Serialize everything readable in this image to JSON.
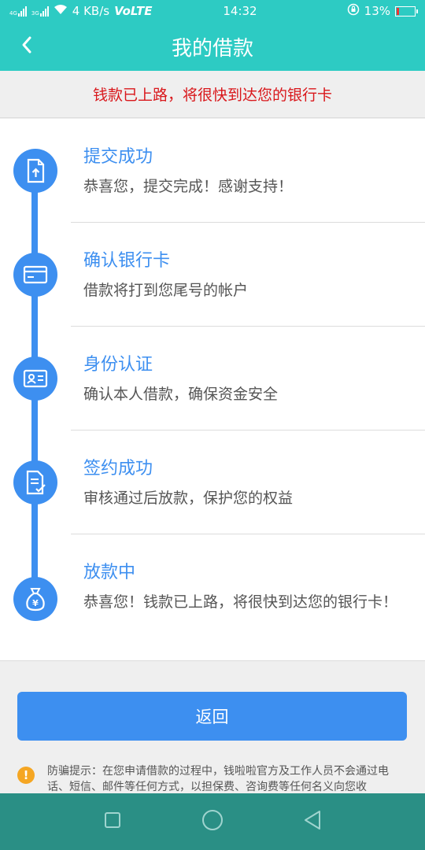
{
  "status_bar": {
    "network_speed": "4 KB/s",
    "volte": "VoLTE",
    "time": "14:32",
    "battery_percent": "13%",
    "battery_level": 0.13,
    "network_labels": [
      "4G",
      "3G"
    ]
  },
  "nav": {
    "title": "我的借款",
    "back_icon": "chevron-left-icon"
  },
  "banner": {
    "message": "钱款已上路，将很快到达您的银行卡"
  },
  "steps": [
    {
      "title": "提交成功",
      "desc": "恭喜您，提交完成！感谢支持！",
      "icon": "document-upload-icon"
    },
    {
      "title": "确认银行卡",
      "desc": "借款将打到您尾号的帐户",
      "icon": "bank-card-icon"
    },
    {
      "title": "身份认证",
      "desc": "确认本人借款，确保资金安全",
      "icon": "id-card-icon"
    },
    {
      "title": "签约成功",
      "desc": "审核通过后放款，保护您的权益",
      "icon": "contract-signed-icon"
    },
    {
      "title": "放款中",
      "desc": "恭喜您！钱款已上路，将很快到达您的银行卡！",
      "icon": "money-bag-icon"
    }
  ],
  "actions": {
    "return_label": "返回"
  },
  "notice": {
    "icon": "warning-icon",
    "text": "防骗提示：在您申请借款的过程中，钱啦啦官方及工作人员不会通过电话、短信、邮件等任何方式，以担保费、咨询费等任何名义向您收"
  },
  "colors": {
    "header": "#2dcbc3",
    "accent": "#3d8ff0",
    "banner_text": "#d9171b",
    "system_nav": "#2a8f85"
  }
}
